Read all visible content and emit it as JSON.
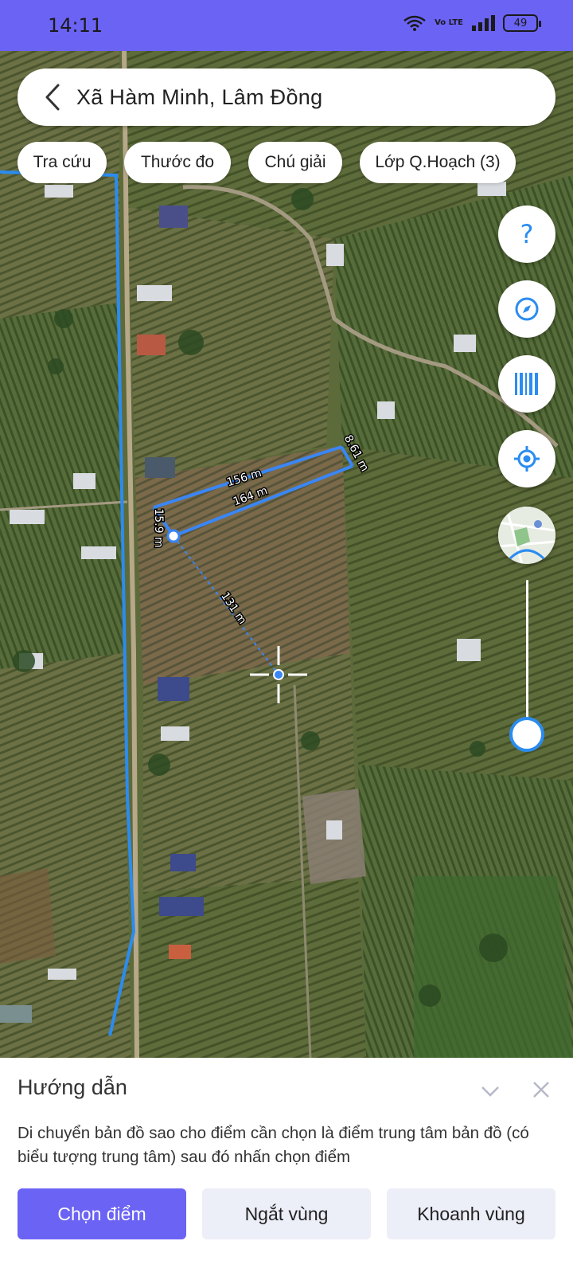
{
  "status_bar": {
    "time": "14:11",
    "network": "Vo LTE",
    "battery": "49"
  },
  "search": {
    "title": "Xã Hàm Minh, Lâm Đồng"
  },
  "chips": [
    {
      "label": "Tra cứu"
    },
    {
      "label": "Thước đo"
    },
    {
      "label": "Chú giải"
    },
    {
      "label": "Lớp Q.Hoạch (3)"
    }
  ],
  "controls": {
    "help_label": "?",
    "icons": [
      "help-icon",
      "compass-icon",
      "barcode-icon",
      "locate-icon",
      "layer-thumbnail",
      "zoom-slider"
    ],
    "zoom_level": 0.1
  },
  "measurements": {
    "labels": [
      "156 m",
      "164 m",
      "8.61 m",
      "15.9 m",
      "131 m"
    ],
    "line_color": "#3a86f5"
  },
  "sheet": {
    "title": "Hướng dẫn",
    "instruction": "Di chuyển bản đồ sao cho điểm cần chọn là điểm trung tâm bản đồ (có biểu tượng trung tâm) sau đó nhấn chọn điểm",
    "buttons": {
      "choose_point": "Chọn điểm",
      "cut_area": "Ngắt vùng",
      "draw_area": "Khoanh vùng"
    }
  },
  "colors": {
    "accent": "#6b63f4",
    "map_blue": "#2b8cf0",
    "secondary_button": "#eceef8"
  }
}
